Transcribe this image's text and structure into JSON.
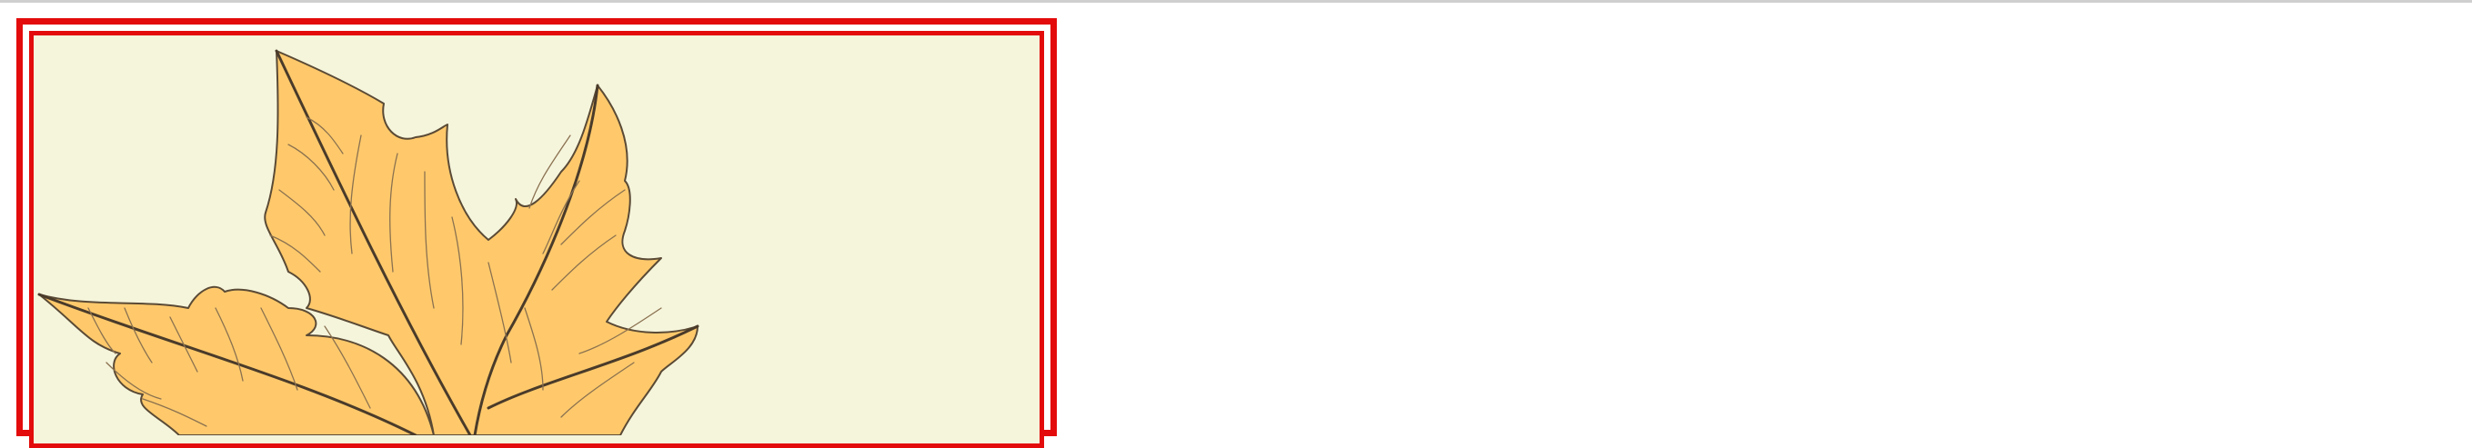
{
  "image": {
    "subject": "leaf-illustration",
    "colors": {
      "frame": "#e30b0b",
      "background": "#f5f5dc",
      "leaf_fill": "#ffc96b",
      "vein": "#4a3b2a",
      "page_rule": "#cfcfcf"
    }
  }
}
